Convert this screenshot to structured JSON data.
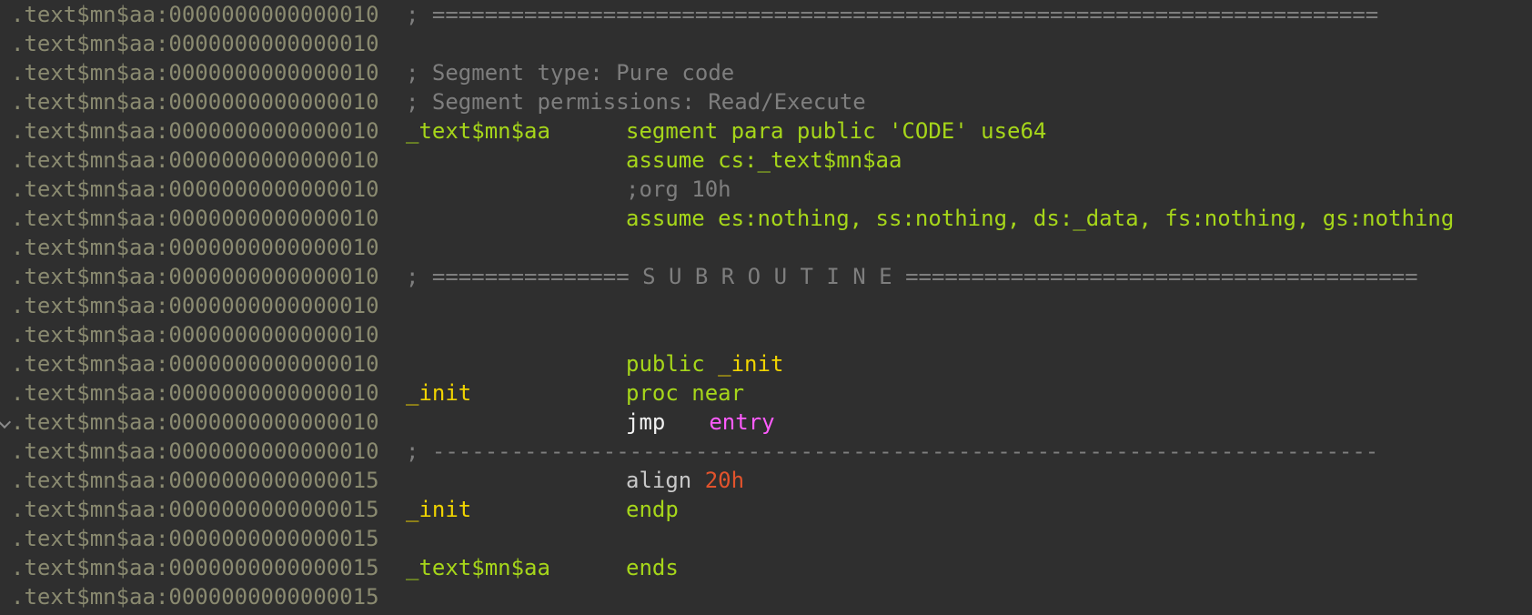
{
  "lines": [
    {
      "addr": ".text$mn$aa:0000000000000010",
      "comment": "; ========================================================================"
    },
    {
      "addr": ".text$mn$aa:0000000000000010"
    },
    {
      "addr": ".text$mn$aa:0000000000000010",
      "comment": "; Segment type: Pure code"
    },
    {
      "addr": ".text$mn$aa:0000000000000010",
      "comment": "; Segment permissions: Read/Execute"
    },
    {
      "addr": ".text$mn$aa:0000000000000010",
      "label": "_text$mn$aa",
      "code": "segment para public 'CODE' use64"
    },
    {
      "addr": ".text$mn$aa:0000000000000010",
      "code": "assume cs:_text$mn$aa"
    },
    {
      "addr": ".text$mn$aa:0000000000000010",
      "code": ";org 10h"
    },
    {
      "addr": ".text$mn$aa:0000000000000010",
      "code": "assume es:nothing, ss:nothing, ds:_data, fs:nothing, gs:nothing"
    },
    {
      "addr": ".text$mn$aa:0000000000000010"
    },
    {
      "addr": ".text$mn$aa:0000000000000010",
      "comment": "; =============== S U B R O U T I N E ======================================="
    },
    {
      "addr": ".text$mn$aa:0000000000000010"
    },
    {
      "addr": ".text$mn$aa:0000000000000010"
    },
    {
      "addr": ".text$mn$aa:0000000000000010",
      "code_kw": "public",
      "code_arg": "_init"
    },
    {
      "addr": ".text$mn$aa:0000000000000010",
      "label": "_init",
      "code": "proc near"
    },
    {
      "addr": ".text$mn$aa:0000000000000010",
      "instr": "jmp",
      "operand": "entry"
    },
    {
      "addr": ".text$mn$aa:0000000000000010",
      "comment": "; ------------------------------------------------------------------------"
    },
    {
      "addr": ".text$mn$aa:0000000000000015",
      "instr": "align",
      "operand": "20h"
    },
    {
      "addr": ".text$mn$aa:0000000000000015",
      "label": "_init",
      "code": "endp"
    },
    {
      "addr": ".text$mn$aa:0000000000000015"
    },
    {
      "addr": ".text$mn$aa:0000000000000015",
      "label": "_text$mn$aa",
      "code": "ends"
    },
    {
      "addr": ".text$mn$aa:0000000000000015"
    }
  ],
  "colors": {
    "background": "#2f2f2f",
    "address": "#8a8a70",
    "keyword": "#a6d61a",
    "name": "#f0d400",
    "comment": "#7e7e7e",
    "instruction": "#f0f0f0",
    "code_ref": "#ff5cff",
    "number": "#e2532c"
  },
  "icons": {
    "fold_marker": "chevron-down-icon"
  }
}
